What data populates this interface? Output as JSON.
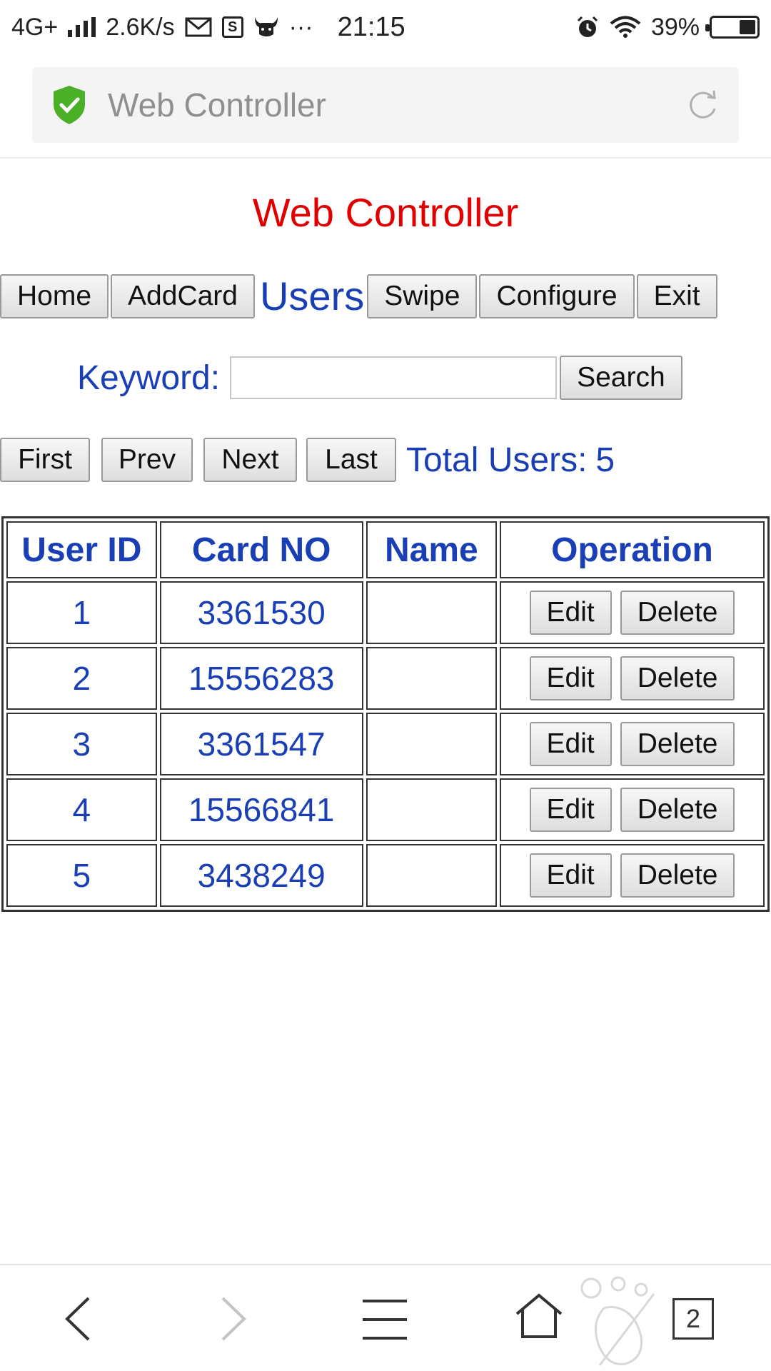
{
  "status_bar": {
    "network": "4G+",
    "speed": "2.6K/s",
    "notif_icons": [
      "mail-icon",
      "s-app-icon",
      "bull-app-icon"
    ],
    "more": "···",
    "time": "21:15",
    "battery": "39%",
    "right_icons": [
      "alarm-icon",
      "wifi-icon",
      "battery-icon"
    ]
  },
  "browser": {
    "address_title": "Web Controller",
    "secure_icon": "shield-check-icon",
    "reload_icon": "reload-icon",
    "tab_count": "2",
    "toolbar_icons": [
      "back-icon",
      "forward-icon",
      "menu-icon",
      "home-icon",
      "mascot-icon",
      "tabs-icon"
    ],
    "shield_color": "#4caf28"
  },
  "page": {
    "title": "Web Controller",
    "title_color": "#e00000",
    "link_color": "#1a3fb5",
    "nav": {
      "home": "Home",
      "add_card": "AddCard",
      "current": "Users",
      "swipe": "Swipe",
      "configure": "Configure",
      "exit": "Exit"
    },
    "search": {
      "label": "Keyword:",
      "value": "",
      "button": "Search"
    },
    "pager": {
      "first": "First",
      "prev": "Prev",
      "next": "Next",
      "last": "Last",
      "total_label": "Total Users:",
      "total": "5"
    },
    "table": {
      "headers": [
        "User ID",
        "Card NO",
        "Name",
        "Operation"
      ],
      "rows": [
        {
          "id": "1",
          "card": "3361530",
          "name": ""
        },
        {
          "id": "2",
          "card": "15556283",
          "name": ""
        },
        {
          "id": "3",
          "card": "3361547",
          "name": ""
        },
        {
          "id": "4",
          "card": "15566841",
          "name": ""
        },
        {
          "id": "5",
          "card": "3438249",
          "name": ""
        }
      ],
      "edit_label": "Edit",
      "delete_label": "Delete"
    }
  }
}
